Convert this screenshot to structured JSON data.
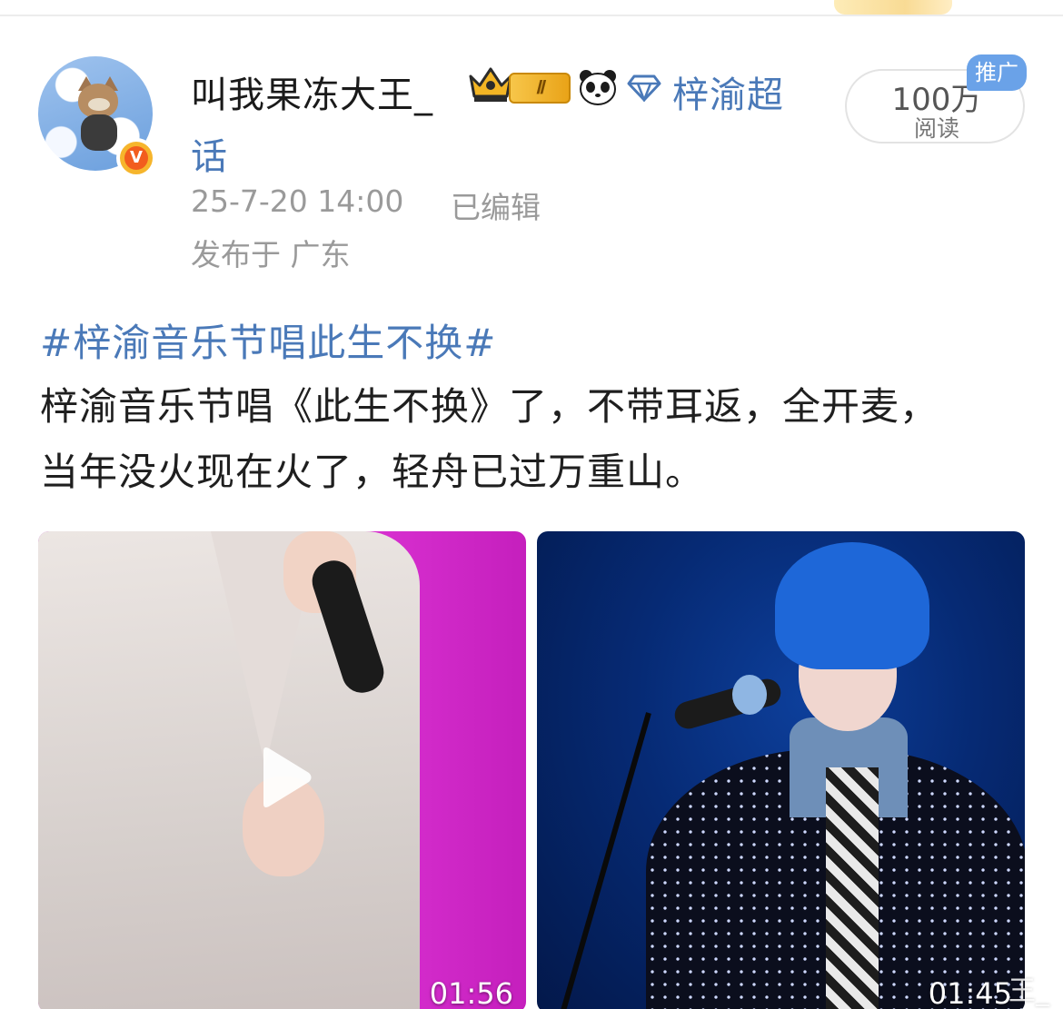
{
  "post": {
    "author": {
      "name": "叫我果冻大王_",
      "level_badge": "Ⅱ",
      "supertopic_line1": "梓渝超",
      "supertopic_line2": "话"
    },
    "timestamp": "25-7-20 14:00",
    "edited_label": "已编辑",
    "location": "发布于 广东",
    "read_count": "100万",
    "read_label": "阅读",
    "promo_badge": "推广",
    "hashtag": "#梓渝音乐节唱此生不换#",
    "body_line1": "梓渝音乐节唱《此生不换》了，不带耳返，全开麦，",
    "body_line2": "当年没火现在火了，轻舟已过万重山。",
    "videos": [
      {
        "duration": "01:56",
        "has_play_icon": true
      },
      {
        "duration": "01:45",
        "has_play_icon": false
      }
    ],
    "watermark": "王_"
  },
  "icons": [
    "crown-icon",
    "panda-icon",
    "diamond-icon",
    "verified-v-icon",
    "play-icon"
  ],
  "colors": {
    "link_blue": "#4a79b8",
    "meta_gray": "#9a9a9a",
    "promo_blue": "#6aa2e8",
    "verified_orange": "#f25d1e"
  }
}
